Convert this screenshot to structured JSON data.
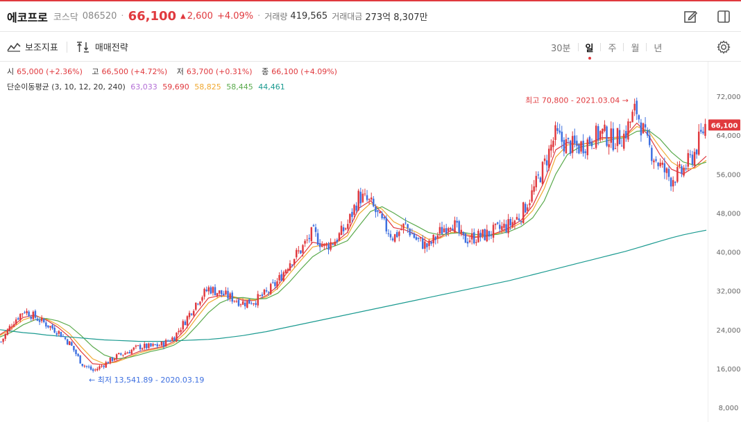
{
  "header": {
    "name": "에코프로",
    "market": "코스닥",
    "code": "086520",
    "dot": "·",
    "price": "66,100",
    "arrow": "▲",
    "change": "2,600",
    "change_pct": "+4.09%",
    "dot2": "·",
    "volume_label": "거래량",
    "volume": "419,565",
    "amount_label": "거래대금",
    "amount": "273억 8,307만",
    "icons": [
      "edit-icon",
      "panel-icon"
    ]
  },
  "toolbar": {
    "indicator_label": "보조지표",
    "strategy_label": "매매전략",
    "periods": [
      "30분",
      "일",
      "주",
      "월",
      "년"
    ],
    "active_period": "일",
    "icons": [
      "indicator-icon",
      "strategy-icon",
      "gear-icon"
    ]
  },
  "ohlc": {
    "open_label": "시",
    "open": "65,000 (+2.36%)",
    "high_label": "고",
    "high": "66,500 (+4.72%)",
    "low_label": "저",
    "low": "63,700 (+0.31%)",
    "close_label": "종",
    "close": "66,100 (+4.09%)"
  },
  "ma": {
    "label": "단순이동평균 (3, 10, 12, 20, 240)",
    "values": [
      {
        "value": "63,033",
        "color": "#b36fd6"
      },
      {
        "value": "59,690",
        "color": "#e0393e"
      },
      {
        "value": "58,825",
        "color": "#f0a830"
      },
      {
        "value": "58,445",
        "color": "#5aaa4c"
      },
      {
        "value": "44,461",
        "color": "#1a9a90"
      }
    ]
  },
  "colors": {
    "up": "#e0393e",
    "down": "#3d6fe0"
  },
  "chart_data": {
    "type": "candlestick",
    "x_range": [
      "2019-10",
      "2021-04"
    ],
    "ylim": [
      8000,
      74000
    ],
    "y_ticks": [
      "72,000",
      "64,000",
      "56,000",
      "48,000",
      "40,000",
      "32,000",
      "24,000",
      "16,000",
      "8,000"
    ],
    "y_tick_values": [
      72000,
      64000,
      56000,
      48000,
      40000,
      32000,
      24000,
      16000,
      8000
    ],
    "last_price_label": "66,100",
    "last_price": 66100,
    "annotations": {
      "high": "최고 70,800 - 2021.03.04 →",
      "low": "← 최저 13,541.89 - 2020.03.19"
    },
    "close_series": [
      21500,
      25500,
      28000,
      26500,
      25000,
      23500,
      21000,
      17000,
      15500,
      17000,
      18500,
      19500,
      20500,
      20500,
      21000,
      22500,
      26000,
      30000,
      32500,
      31500,
      30500,
      29500,
      30000,
      31500,
      34000,
      38000,
      40500,
      44000,
      41000,
      42500,
      45500,
      51500,
      50000,
      46000,
      43000,
      45500,
      42500,
      41000,
      44000,
      46500,
      42500,
      43000,
      43500,
      44500,
      45500,
      47500,
      52000,
      57500,
      64000,
      62000,
      61500,
      63000,
      64500,
      63000,
      64000,
      69500,
      62000,
      58000,
      55000,
      56500,
      60000,
      66100
    ],
    "ma_series": [
      {
        "name": "10",
        "values": [
          23000,
          24500,
          26500,
          27000,
          26000,
          24500,
          22500,
          19500,
          17000,
          16800,
          17500,
          18500,
          19500,
          20000,
          20500,
          21500,
          24000,
          27500,
          30500,
          31000,
          30800,
          30000,
          30000,
          31000,
          33000,
          36500,
          39000,
          42000,
          41500,
          42000,
          44000,
          49000,
          50500,
          48000,
          45000,
          44500,
          43500,
          42000,
          43000,
          44500,
          43500,
          43000,
          43200,
          44000,
          45000,
          46500,
          49500,
          54500,
          61000,
          62500,
          62000,
          62500,
          63500,
          63500,
          63800,
          66500,
          64000,
          60000,
          57000,
          56000,
          57500,
          59690
        ]
      },
      {
        "name": "12",
        "values": [
          22800,
          24200,
          26000,
          26800,
          26200,
          25000,
          23200,
          20500,
          18000,
          17000,
          17300,
          18200,
          19200,
          19800,
          20300,
          21200,
          23300,
          26500,
          29500,
          30800,
          30900,
          30300,
          30100,
          30700,
          32500,
          35500,
          38300,
          41000,
          41500,
          41800,
          43300,
          47800,
          50000,
          48800,
          46200,
          45000,
          44000,
          42600,
          42800,
          44000,
          43800,
          43200,
          43200,
          43800,
          44700,
          46000,
          48500,
          53000,
          59500,
          62000,
          62200,
          62300,
          63200,
          63500,
          63700,
          65800,
          64800,
          61500,
          58500,
          57000,
          57200,
          58825
        ]
      },
      {
        "name": "20",
        "values": [
          22500,
          23500,
          25000,
          26000,
          26300,
          25800,
          24800,
          22800,
          20500,
          18800,
          18000,
          18200,
          18800,
          19500,
          20000,
          20800,
          22300,
          24800,
          27500,
          29500,
          30500,
          30600,
          30300,
          30400,
          31500,
          33800,
          36500,
          39000,
          40500,
          41300,
          42300,
          45300,
          48300,
          49300,
          48000,
          46500,
          45300,
          44000,
          43500,
          43800,
          44000,
          43600,
          43400,
          43600,
          44200,
          45200,
          47000,
          50500,
          56000,
          60000,
          61500,
          62000,
          62600,
          63200,
          63500,
          64800,
          65000,
          63200,
          60500,
          58500,
          57800,
          58445
        ]
      },
      {
        "name": "240",
        "values": [
          24000,
          23700,
          23400,
          23200,
          22900,
          22700,
          22500,
          22300,
          22100,
          21900,
          21800,
          21700,
          21600,
          21600,
          21600,
          21700,
          21800,
          21900,
          22000,
          22200,
          22500,
          22800,
          23200,
          23600,
          24100,
          24600,
          25100,
          25600,
          26100,
          26600,
          27100,
          27600,
          28100,
          28600,
          29100,
          29600,
          30100,
          30600,
          31100,
          31600,
          32100,
          32600,
          33100,
          33600,
          34100,
          34700,
          35300,
          35900,
          36500,
          37100,
          37700,
          38300,
          38900,
          39500,
          40100,
          40800,
          41500,
          42200,
          42900,
          43500,
          44000,
          44461
        ]
      }
    ]
  }
}
